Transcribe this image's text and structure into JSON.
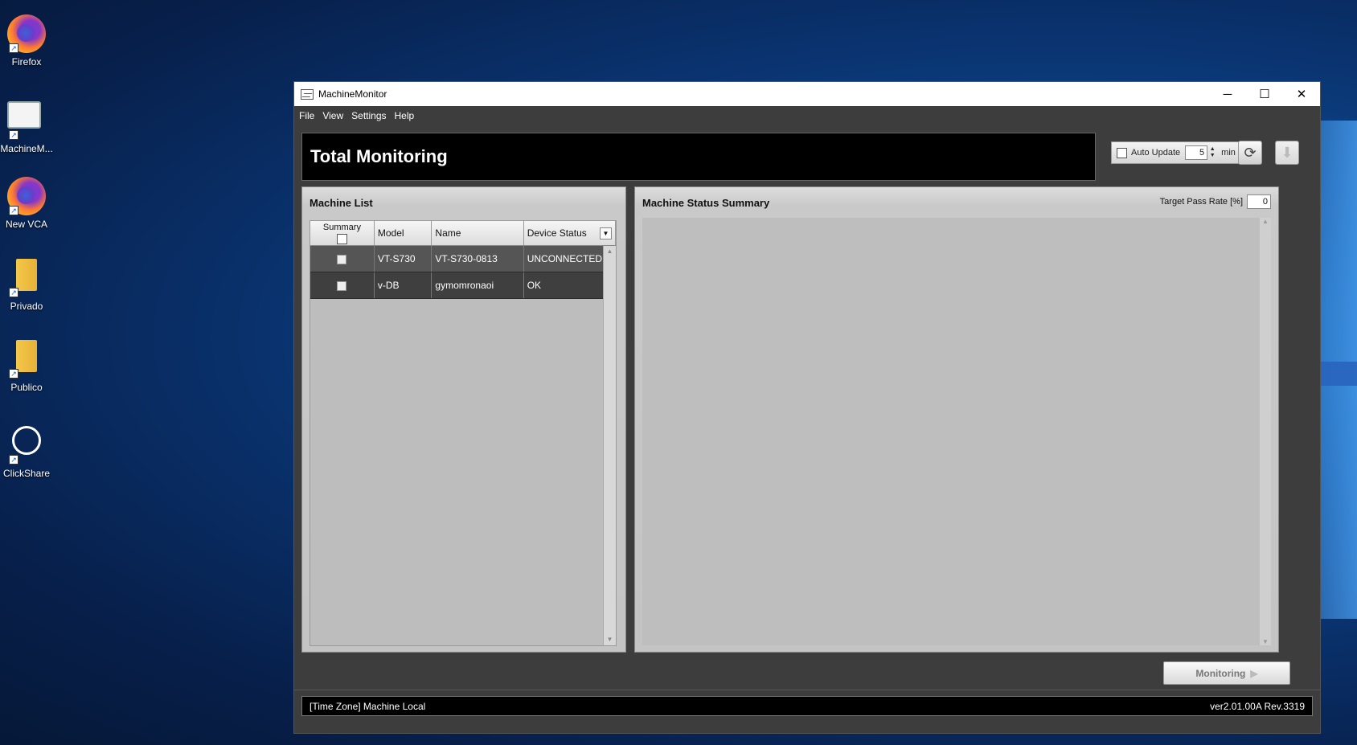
{
  "desktop": {
    "icons": [
      {
        "label": "Firefox",
        "icon": "firefox-icon"
      },
      {
        "label": "MachineM...",
        "icon": "machinemonitor-icon"
      },
      {
        "label": "New VCA",
        "icon": "firefox-icon"
      },
      {
        "label": "Privado",
        "icon": "folder-icon"
      },
      {
        "label": "Publico",
        "icon": "folder-icon"
      },
      {
        "label": "ClickShare",
        "icon": "clickshare-icon"
      }
    ]
  },
  "window": {
    "title": "MachineMonitor",
    "controls": {
      "minimize": "─",
      "maximize": "☐",
      "close": "✕"
    }
  },
  "menu": {
    "file": "File",
    "view": "View",
    "settings": "Settings",
    "help": "Help"
  },
  "header": {
    "title": "Total Monitoring",
    "auto_update_label": "Auto Update",
    "auto_update_checked": false,
    "interval_value": "5",
    "interval_unit": "min"
  },
  "machine_list": {
    "title": "Machine List",
    "columns": {
      "summary": "Summary",
      "model": "Model",
      "name": "Name",
      "device_status": "Device Status"
    },
    "rows": [
      {
        "checked": false,
        "model": "VT-S730",
        "name": "VT-S730-0813",
        "status": "UNCONNECTED"
      },
      {
        "checked": false,
        "model": "v-DB",
        "name": "gymomronaoi",
        "status": "OK"
      }
    ]
  },
  "status_summary": {
    "title": "Machine Status Summary",
    "target_pass_rate_label": "Target Pass Rate [%]",
    "target_pass_rate_value": "0"
  },
  "actions": {
    "monitoring_label": "Monitoring"
  },
  "statusbar": {
    "time_zone": "[Time Zone] Machine Local",
    "version": "ver2.01.00A Rev.3319"
  },
  "colors": {
    "window_bg": "#3d3d3d",
    "header_bg": "#000000",
    "row_bg": "#3f3f3f",
    "desktop_blue": "#0a3471"
  }
}
